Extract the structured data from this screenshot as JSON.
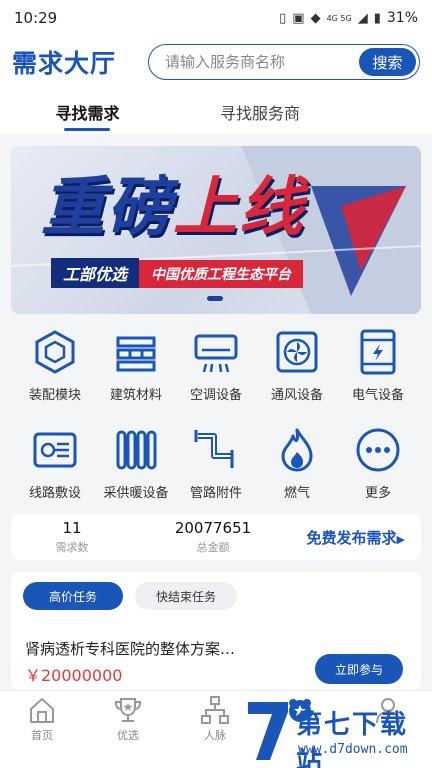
{
  "status_bar": {
    "time": "10:29",
    "battery": "31%",
    "network": "4G 5G"
  },
  "header": {
    "title": "需求大厅",
    "search_placeholder": "请输入服务商名称",
    "search_button": "搜索"
  },
  "tabs": [
    {
      "label": "寻找需求",
      "active": true
    },
    {
      "label": "寻找服务商",
      "active": false
    }
  ],
  "banner": {
    "headline_main": "重磅",
    "headline_accent": "上线",
    "tag_left": "工部优选",
    "tag_right": "中国优质工程生态平台"
  },
  "categories": [
    {
      "label": "装配模块",
      "icon": "cube-icon"
    },
    {
      "label": "建筑材料",
      "icon": "building-material-icon"
    },
    {
      "label": "空调设备",
      "icon": "air-conditioner-icon"
    },
    {
      "label": "通风设备",
      "icon": "fan-icon"
    },
    {
      "label": "电气设备",
      "icon": "electric-cabinet-icon"
    },
    {
      "label": "线路敷设",
      "icon": "cable-icon"
    },
    {
      "label": "采供暖设备",
      "icon": "radiator-icon"
    },
    {
      "label": "管路附件",
      "icon": "pipe-icon"
    },
    {
      "label": "燃气",
      "icon": "flame-icon"
    },
    {
      "label": "更多",
      "icon": "more-icon"
    }
  ],
  "stats": {
    "demand_count": {
      "value": "11",
      "label": "需求数"
    },
    "total_amount": {
      "value": "20077651",
      "label": "总金额"
    },
    "publish_link": "免费发布需求"
  },
  "tasks": {
    "tabs": [
      {
        "label": "高价任务",
        "active": true
      },
      {
        "label": "快结束任务",
        "active": false
      }
    ],
    "item": {
      "title": "肾病透析专科医院的整体方案…",
      "price": "￥20000000",
      "action": "立即参与"
    }
  },
  "bottom_nav": [
    {
      "label": "首页",
      "icon": "home-icon"
    },
    {
      "label": "优选",
      "icon": "trophy-icon"
    },
    {
      "label": "人脉",
      "icon": "network-icon"
    },
    {
      "label": "",
      "icon": "bear-icon"
    },
    {
      "label": "",
      "icon": "user-icon"
    }
  ],
  "watermark": {
    "text": "第七下载站",
    "url": "www.d7down.com"
  },
  "colors": {
    "brand": "#1a56b8",
    "price": "#e23a3a",
    "banner_red": "#d8263a"
  }
}
